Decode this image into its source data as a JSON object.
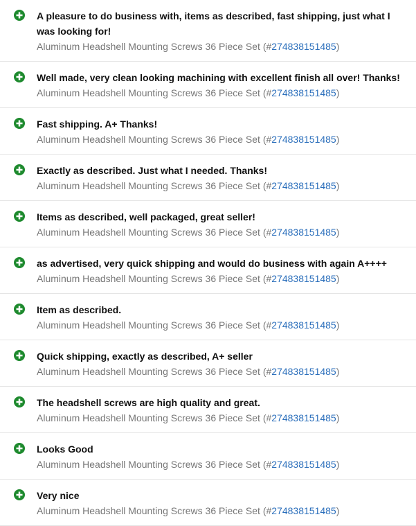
{
  "colors": {
    "positive": "#1e8a2e",
    "link": "#2a6ebb",
    "item_text": "#767676",
    "comment_text": "#111111"
  },
  "feedback": [
    {
      "icon": "positive-feedback-icon",
      "comment": "A pleasure to do business with, items as described, fast shipping, just what I was looking for!",
      "item_prefix": "Aluminum Headshell Mounting Screws 36 Piece Set (#",
      "item_number": "274838151485",
      "item_suffix": ")"
    },
    {
      "icon": "positive-feedback-icon",
      "comment": "Well made, very clean looking machining with excellent finish all over! Thanks!",
      "item_prefix": "Aluminum Headshell Mounting Screws 36 Piece Set (#",
      "item_number": "274838151485",
      "item_suffix": ")"
    },
    {
      "icon": "positive-feedback-icon",
      "comment": "Fast shipping. A+ Thanks!",
      "item_prefix": "Aluminum Headshell Mounting Screws 36 Piece Set (#",
      "item_number": "274838151485",
      "item_suffix": ")"
    },
    {
      "icon": "positive-feedback-icon",
      "comment": "Exactly as described. Just what I needed. Thanks!",
      "item_prefix": "Aluminum Headshell Mounting Screws 36 Piece Set (#",
      "item_number": "274838151485",
      "item_suffix": ")"
    },
    {
      "icon": "positive-feedback-icon",
      "comment": "Items as described, well packaged, great seller!",
      "item_prefix": "Aluminum Headshell Mounting Screws 36 Piece Set (#",
      "item_number": "274838151485",
      "item_suffix": ")"
    },
    {
      "icon": "positive-feedback-icon",
      "comment": "as advertised, very quick shipping and would do business with again A++++",
      "item_prefix": "Aluminum Headshell Mounting Screws 36 Piece Set (#",
      "item_number": "274838151485",
      "item_suffix": ")"
    },
    {
      "icon": "positive-feedback-icon",
      "comment": "Item as described.",
      "item_prefix": "Aluminum Headshell Mounting Screws 36 Piece Set (#",
      "item_number": "274838151485",
      "item_suffix": ")"
    },
    {
      "icon": "positive-feedback-icon",
      "comment": "Quick shipping, exactly as described, A+ seller",
      "item_prefix": "Aluminum Headshell Mounting Screws 36 Piece Set (#",
      "item_number": "274838151485",
      "item_suffix": ")"
    },
    {
      "icon": "positive-feedback-icon",
      "comment": "The headshell screws are high quality and great.",
      "item_prefix": "Aluminum Headshell Mounting Screws 36 Piece Set (#",
      "item_number": "274838151485",
      "item_suffix": ")"
    },
    {
      "icon": "positive-feedback-icon",
      "comment": "Looks Good",
      "item_prefix": "Aluminum Headshell Mounting Screws 36 Piece Set (#",
      "item_number": "274838151485",
      "item_suffix": ")"
    },
    {
      "icon": "positive-feedback-icon",
      "comment": "Very nice",
      "item_prefix": "Aluminum Headshell Mounting Screws 36 Piece Set (#",
      "item_number": "274838151485",
      "item_suffix": ")"
    }
  ]
}
